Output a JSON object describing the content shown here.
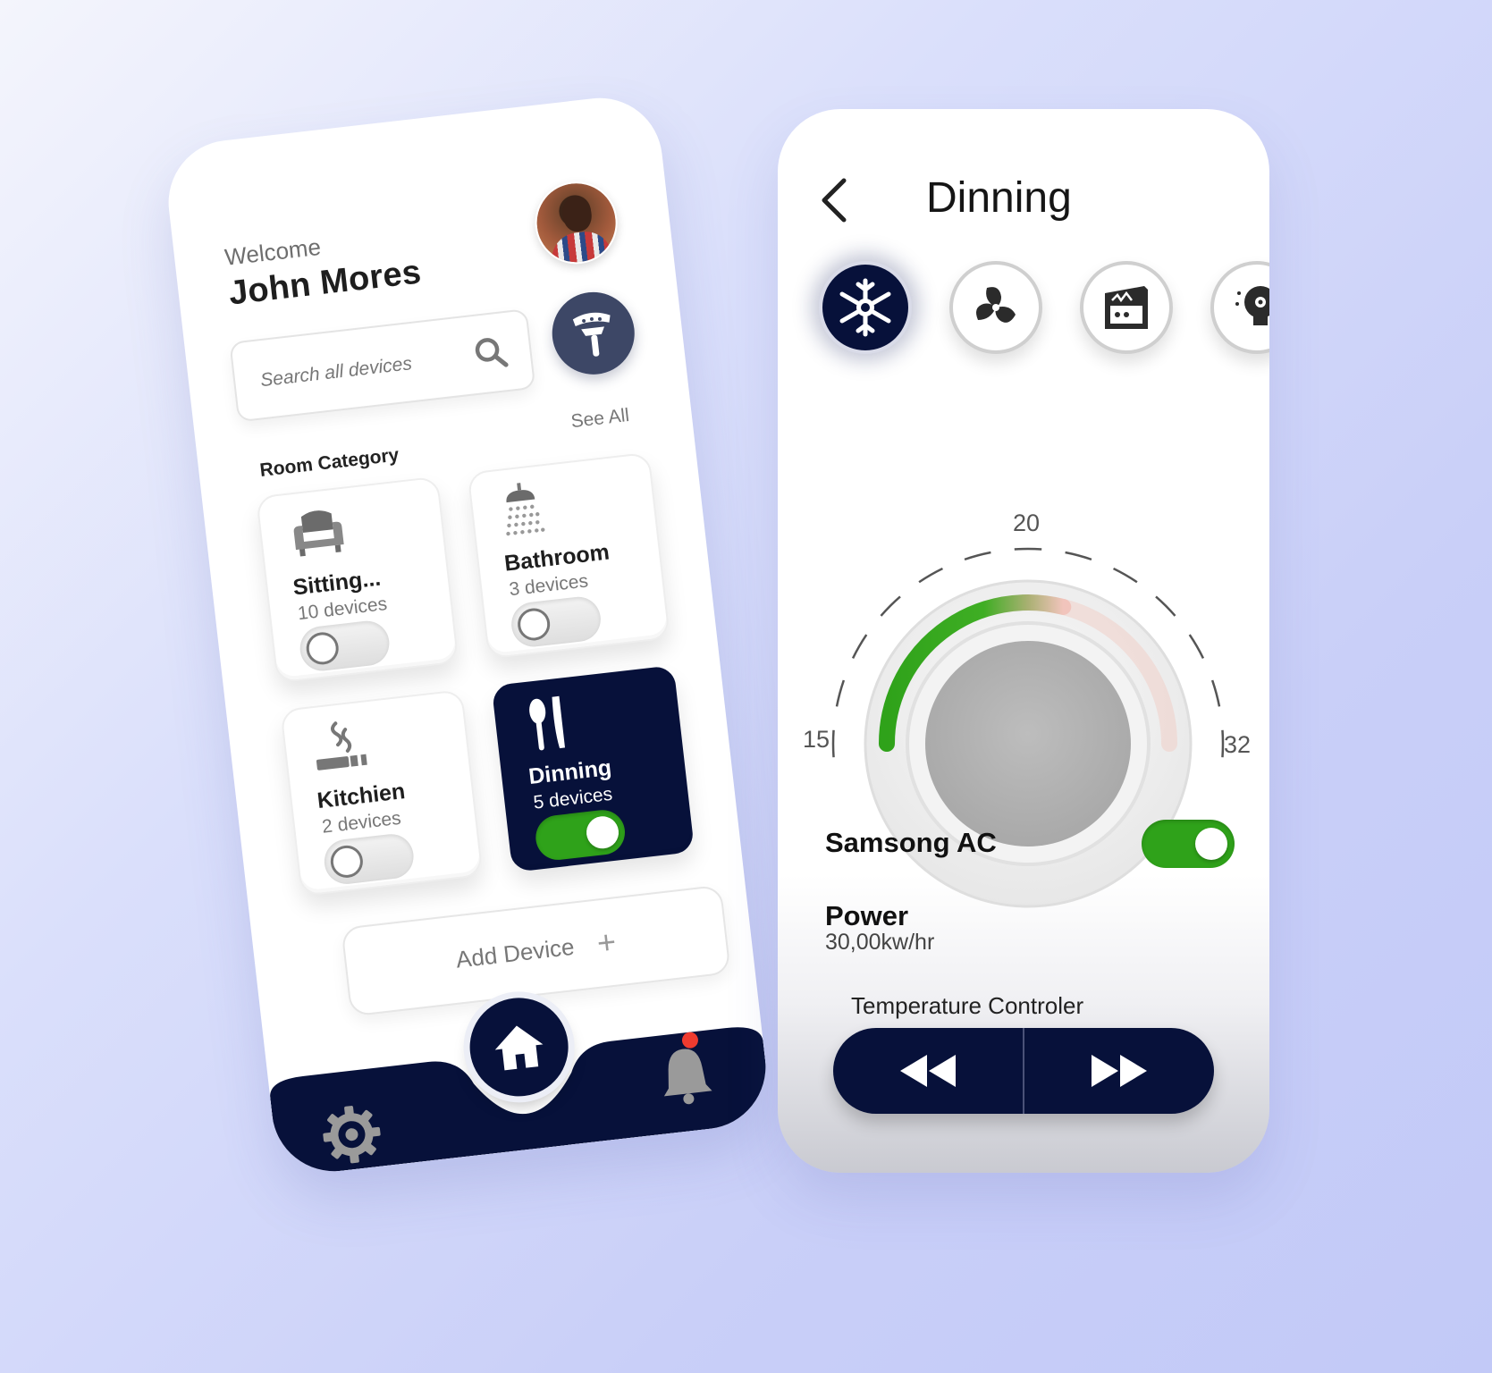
{
  "home": {
    "welcome": "Welcome",
    "user_name": "John Mores",
    "search_placeholder": "Search all devices",
    "room_category_label": "Room Category",
    "see_all_label": "See All",
    "rooms": [
      {
        "name": "Sitting...",
        "devices": "10 devices",
        "icon": "armchair-icon",
        "on": false,
        "active": false
      },
      {
        "name": "Bathroom",
        "devices": "3 devices",
        "icon": "shower-icon",
        "on": false,
        "active": false
      },
      {
        "name": "Kitchien",
        "devices": "2 devices",
        "icon": "stove-icon",
        "on": false,
        "active": false
      },
      {
        "name": "Dinning",
        "devices": "5 devices",
        "icon": "cutlery-icon",
        "on": true,
        "active": true
      }
    ],
    "add_device_label": "Add Device",
    "add_device_plus": "+",
    "nav": [
      "gear-icon",
      "home-icon",
      "bell-icon"
    ],
    "notification_dot": true
  },
  "detail": {
    "title": "Dinning",
    "devices": [
      "snowflake-icon",
      "fan-icon",
      "oven-icon",
      "smart-bulb-icon"
    ],
    "active_device": "snowflake-icon",
    "dial": {
      "min_label": "15",
      "mid_label": "20",
      "max_label": "32",
      "level_fraction": 0.58
    },
    "ac_name": "Samsong AC",
    "ac_on": true,
    "power_label": "Power",
    "power_value": "30,00kw/hr",
    "temp_label": "Temperature Controler",
    "controls": [
      "rewind-icon",
      "fast-forward-icon"
    ]
  },
  "colors": {
    "navy": "#07113a",
    "green": "#2fa21a",
    "alert_red": "#ee3b2f",
    "background_tint": "#c9cff8"
  }
}
